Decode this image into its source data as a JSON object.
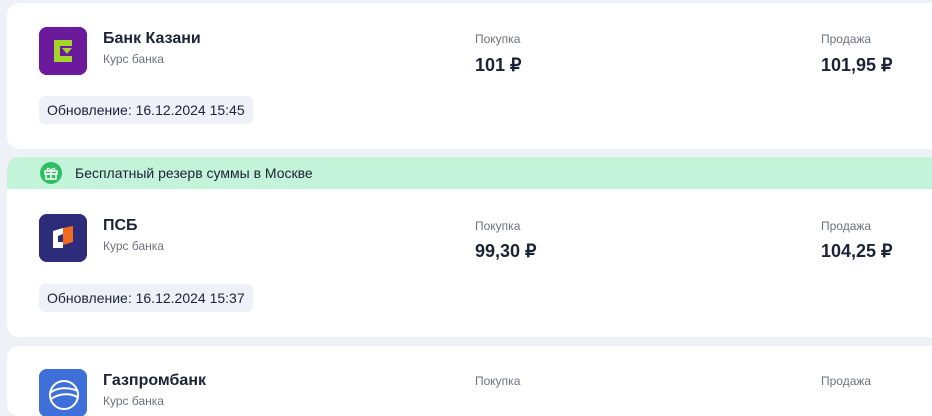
{
  "promo": {
    "icon": "gift-icon",
    "text": "Бесплатный резерв суммы в Москве",
    "color": "#c3f3d9",
    "icon_color": "#2ebf63"
  },
  "columns": {
    "buy_label": "Покупка",
    "sell_label": "Продажа"
  },
  "banks": [
    {
      "name": "Банк Казани",
      "subtitle": "Курс банка",
      "buy": "101 ₽",
      "sell": "101,95 ₽",
      "updated": "Обновление: 16.12.2024 15:45",
      "logo_color": "#6a1a9a",
      "logo_accent": "#a4d42b"
    },
    {
      "name": "ПСБ",
      "subtitle": "Курс банка",
      "buy": "99,30 ₽",
      "sell": "104,25 ₽",
      "updated": "Обновление: 16.12.2024 15:37",
      "logo_color": "#2c2c7a",
      "logo_accent": "#f26b21"
    },
    {
      "name": "Газпромбанк",
      "subtitle": "Курс банка",
      "logo_color": "#3f6fd8"
    }
  ]
}
